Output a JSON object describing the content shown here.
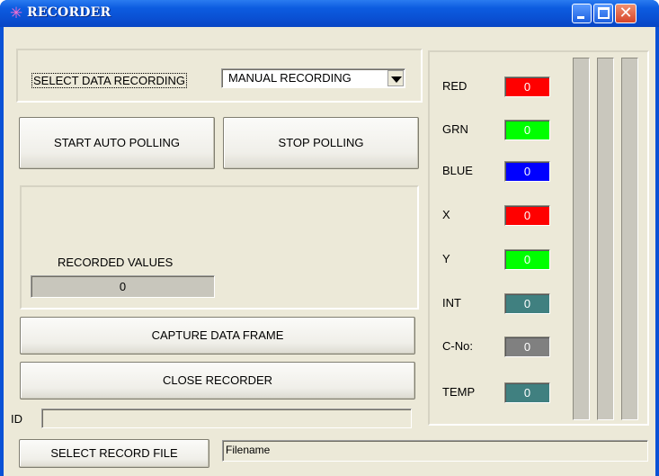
{
  "window": {
    "title": "RECORDER",
    "icon": "sparkle-icon"
  },
  "select_recording": {
    "label": "SELECT DATA RECORDING",
    "value": "MANUAL RECORDING"
  },
  "buttons": {
    "start_auto_polling": "START AUTO POLLING",
    "stop_polling": "STOP POLLING",
    "capture_data_frame": "CAPTURE DATA FRAME",
    "close_recorder": "CLOSE RECORDER",
    "select_record_file": "SELECT RECORD FILE"
  },
  "recorded": {
    "label": "RECORDED VALUES",
    "value": "0"
  },
  "id_field": {
    "label": "ID",
    "value": ""
  },
  "filename_field": {
    "value": "Filename"
  },
  "readouts": [
    {
      "label": "RED",
      "value": "0",
      "color": "#ff0000"
    },
    {
      "label": "GRN",
      "value": "0",
      "color": "#00ff00"
    },
    {
      "label": "BLUE",
      "value": "0",
      "color": "#0000ff"
    },
    {
      "label": "X",
      "value": "0",
      "color": "#ff0000"
    },
    {
      "label": "Y",
      "value": "0",
      "color": "#00ff00"
    },
    {
      "label": "INT",
      "value": "0",
      "color": "#408080"
    },
    {
      "label": "C-No:",
      "value": "0",
      "color": "#808080"
    },
    {
      "label": "TEMP",
      "value": "0",
      "color": "#408080"
    }
  ]
}
